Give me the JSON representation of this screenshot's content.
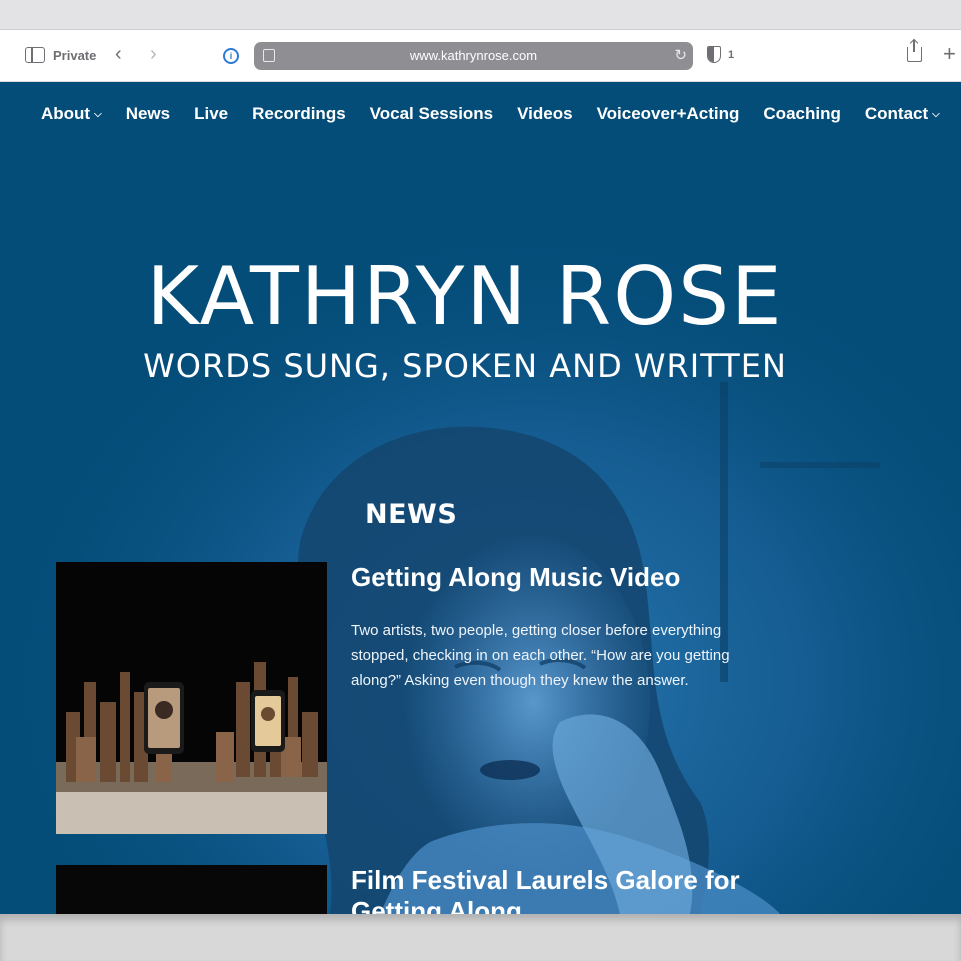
{
  "browser": {
    "private_label": "Private",
    "url": "www.kathrynrose.com",
    "blocker_count": "1"
  },
  "nav": {
    "items": [
      {
        "label": "About",
        "has_dropdown": true
      },
      {
        "label": "News",
        "has_dropdown": false
      },
      {
        "label": "Live",
        "has_dropdown": false
      },
      {
        "label": "Recordings",
        "has_dropdown": false
      },
      {
        "label": "Vocal Sessions",
        "has_dropdown": false
      },
      {
        "label": "Videos",
        "has_dropdown": false
      },
      {
        "label": "Voiceover+Acting",
        "has_dropdown": false
      },
      {
        "label": "Coaching",
        "has_dropdown": false
      },
      {
        "label": "Contact",
        "has_dropdown": true
      }
    ]
  },
  "hero": {
    "title": "KATHRYN ROSE",
    "tagline": "WORDS SUNG, SPOKEN AND WRITTEN"
  },
  "news": {
    "section_title": "NEWS",
    "posts": [
      {
        "title": "Getting Along Music Video",
        "excerpt": "Two artists, two people, getting closer before everything stopped, checking in on each other. “How are you getting along?” Asking even though they knew the answer."
      },
      {
        "title": "Film Festival Laurels Galore for Getting Along",
        "excerpt": ""
      }
    ]
  },
  "colors": {
    "page_bg": "#054d79",
    "text": "#ffffff"
  }
}
